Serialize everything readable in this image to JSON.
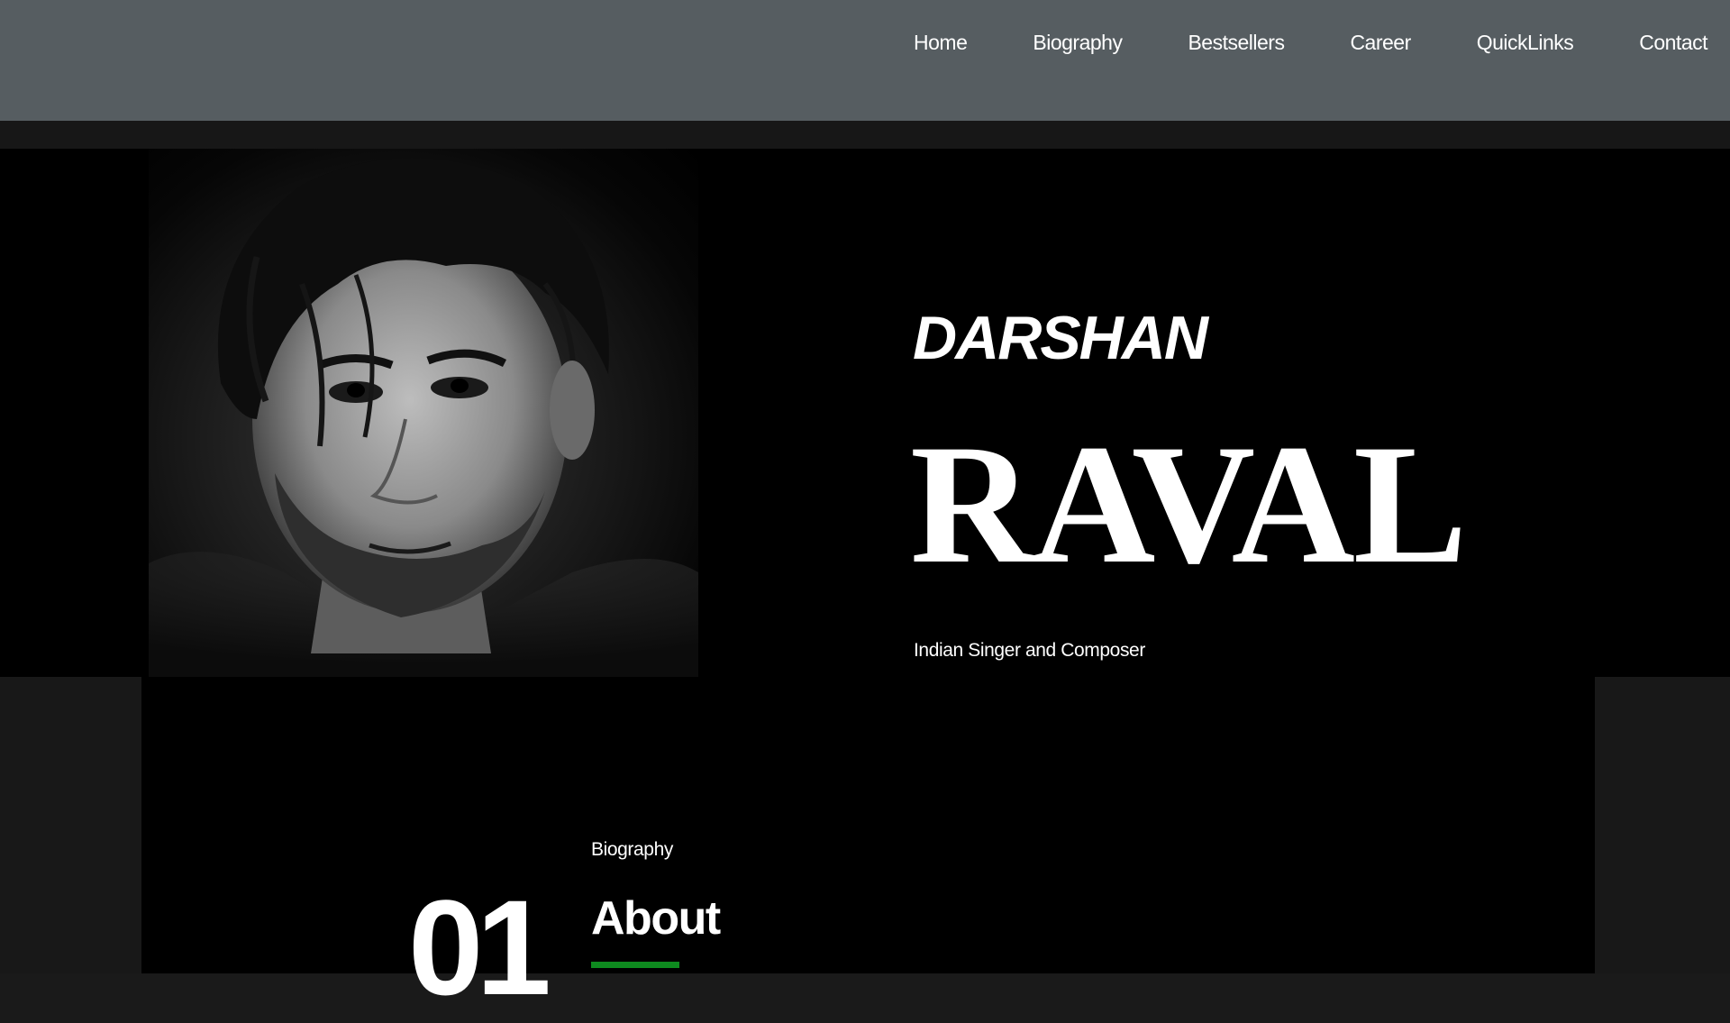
{
  "nav": {
    "items": [
      {
        "label": "Home"
      },
      {
        "label": "Biography"
      },
      {
        "label": "Bestsellers"
      },
      {
        "label": "Career"
      },
      {
        "label": "QuickLinks"
      },
      {
        "label": "Contact"
      }
    ]
  },
  "hero": {
    "first_name": "DARSHAN",
    "last_name": "RAVAL",
    "subtitle": "Indian Singer and Composer",
    "portrait_icon": "portrait-photo"
  },
  "about": {
    "number": "01",
    "eyebrow": "Biography",
    "title": "About",
    "accent_color": "#0e8a1f"
  },
  "colors": {
    "navbar_bg": "#565d61",
    "hero_bg": "#000000",
    "band_bg": "#181818"
  }
}
